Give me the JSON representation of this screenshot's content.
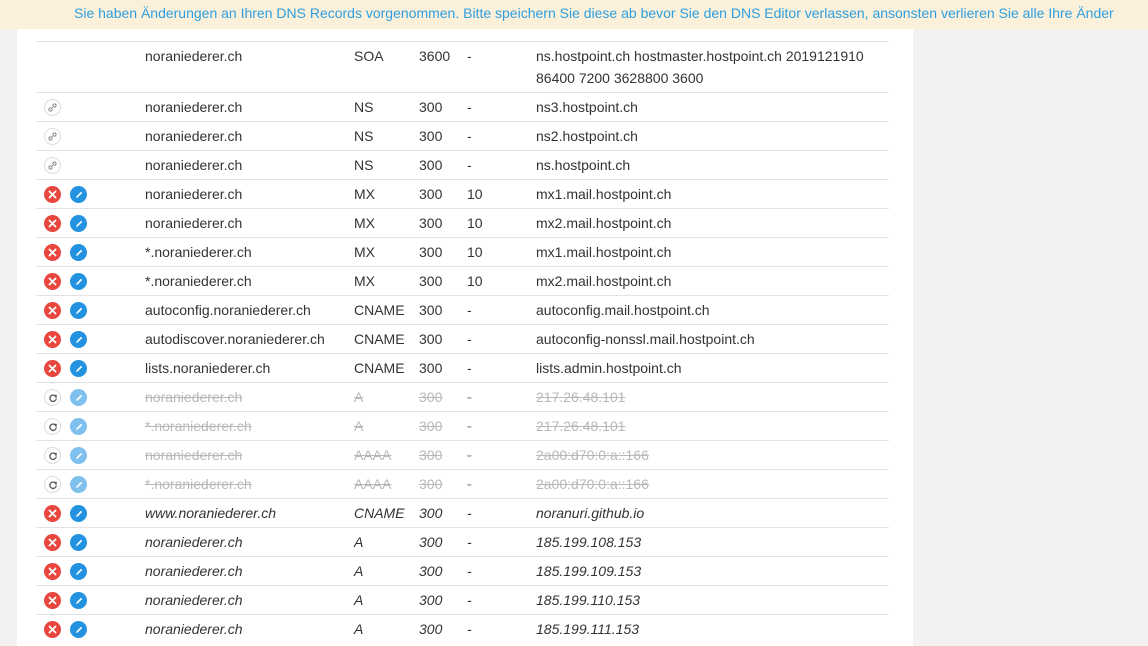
{
  "banner": {
    "text": "Sie haben Änderungen an Ihren DNS Records vorgenommen. Bitte speichern Sie diese ab bevor Sie den DNS Editor verlassen, ansonsten verlieren Sie alle Ihre Änder"
  },
  "colors": {
    "banner_bg": "#fbf0d9",
    "banner_text": "#2e9fe0",
    "delete": "#e8473f",
    "edit": "#2392e0"
  },
  "records": [
    {
      "state": "soa",
      "actions": "none",
      "name": "noraniederer.ch",
      "type": "SOA",
      "ttl": "3600",
      "prio": "-",
      "value": "ns.hostpoint.ch hostmaster.hostpoint.ch 2019121910 86400 7200 3628800 3600"
    },
    {
      "state": "system",
      "actions": "link",
      "name": "noraniederer.ch",
      "type": "NS",
      "ttl": "300",
      "prio": "-",
      "value": "ns3.hostpoint.ch"
    },
    {
      "state": "system",
      "actions": "link",
      "name": "noraniederer.ch",
      "type": "NS",
      "ttl": "300",
      "prio": "-",
      "value": "ns2.hostpoint.ch"
    },
    {
      "state": "system",
      "actions": "link",
      "name": "noraniederer.ch",
      "type": "NS",
      "ttl": "300",
      "prio": "-",
      "value": "ns.hostpoint.ch"
    },
    {
      "state": "normal",
      "actions": "edit",
      "name": "noraniederer.ch",
      "type": "MX",
      "ttl": "300",
      "prio": "10",
      "value": "mx1.mail.hostpoint.ch"
    },
    {
      "state": "normal",
      "actions": "edit",
      "name": "noraniederer.ch",
      "type": "MX",
      "ttl": "300",
      "prio": "10",
      "value": "mx2.mail.hostpoint.ch"
    },
    {
      "state": "normal",
      "actions": "edit",
      "name": "*.noraniederer.ch",
      "type": "MX",
      "ttl": "300",
      "prio": "10",
      "value": "mx1.mail.hostpoint.ch"
    },
    {
      "state": "normal",
      "actions": "edit",
      "name": "*.noraniederer.ch",
      "type": "MX",
      "ttl": "300",
      "prio": "10",
      "value": "mx2.mail.hostpoint.ch"
    },
    {
      "state": "normal",
      "actions": "edit",
      "name": "autoconfig.noraniederer.ch",
      "type": "CNAME",
      "ttl": "300",
      "prio": "-",
      "value": "autoconfig.mail.hostpoint.ch"
    },
    {
      "state": "normal",
      "actions": "edit",
      "name": "autodiscover.noraniederer.ch",
      "type": "CNAME",
      "ttl": "300",
      "prio": "-",
      "value": "autoconfig-nonssl.mail.hostpoint.ch"
    },
    {
      "state": "normal",
      "actions": "edit",
      "name": "lists.noraniederer.ch",
      "type": "CNAME",
      "ttl": "300",
      "prio": "-",
      "value": "lists.admin.hostpoint.ch"
    },
    {
      "state": "deleted",
      "actions": "restore",
      "name": "noraniederer.ch",
      "type": "A",
      "ttl": "300",
      "prio": "-",
      "value": "217.26.48.101"
    },
    {
      "state": "deleted",
      "actions": "restore",
      "name": "*.noraniederer.ch",
      "type": "A",
      "ttl": "300",
      "prio": "-",
      "value": "217.26.48.101"
    },
    {
      "state": "deleted",
      "actions": "restore",
      "name": "noraniederer.ch",
      "type": "AAAA",
      "ttl": "300",
      "prio": "-",
      "value": "2a00:d70:0:a::166"
    },
    {
      "state": "deleted",
      "actions": "restore",
      "name": "*.noraniederer.ch",
      "type": "AAAA",
      "ttl": "300",
      "prio": "-",
      "value": "2a00:d70:0:a::166"
    },
    {
      "state": "new",
      "actions": "edit",
      "name": "www.noraniederer.ch",
      "type": "CNAME",
      "ttl": "300",
      "prio": "-",
      "value": "noranuri.github.io"
    },
    {
      "state": "new",
      "actions": "edit",
      "name": "noraniederer.ch",
      "type": "A",
      "ttl": "300",
      "prio": "-",
      "value": "185.199.108.153"
    },
    {
      "state": "new",
      "actions": "edit",
      "name": "noraniederer.ch",
      "type": "A",
      "ttl": "300",
      "prio": "-",
      "value": "185.199.109.153"
    },
    {
      "state": "new",
      "actions": "edit",
      "name": "noraniederer.ch",
      "type": "A",
      "ttl": "300",
      "prio": "-",
      "value": "185.199.110.153"
    },
    {
      "state": "new",
      "actions": "edit",
      "name": "noraniederer.ch",
      "type": "A",
      "ttl": "300",
      "prio": "-",
      "value": "185.199.111.153"
    }
  ]
}
